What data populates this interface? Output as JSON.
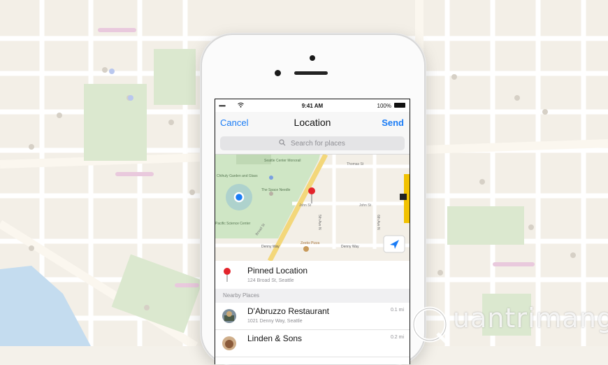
{
  "status_bar": {
    "signal": "•••••",
    "time": "9:41 AM",
    "battery": "100%"
  },
  "nav": {
    "cancel": "Cancel",
    "title": "Location",
    "send": "Send"
  },
  "search": {
    "placeholder": "Search for places"
  },
  "map_labels": {
    "seattle_center": "Seattle Center Monorail",
    "chihuly": "Chihuly Garden and Glass",
    "thomas": "Thomas St",
    "space_needle": "The Space Needle",
    "john": "John St",
    "john2": "John St",
    "fifth": "5th Ave N",
    "sixth": "6th Ave N",
    "science": "Pacific Science Center",
    "broad": "Broad St",
    "denny1": "Denny Way",
    "zeeks": "Zeeks Pizza",
    "denny2": "Denny Way"
  },
  "pinned": {
    "title": "Pinned Location",
    "address": "124 Broad St, Seattle"
  },
  "section": {
    "nearby": "Nearby Places"
  },
  "places": [
    {
      "name": "D'Abruzzo Restaurant",
      "address": "1021 Denny Way, Seattle",
      "distance": "0.1 mi"
    },
    {
      "name": "Linden & Sons",
      "address": "",
      "distance": "0.2 mi"
    }
  ],
  "watermark": {
    "text": "uantrimang"
  },
  "colors": {
    "accent": "#1a7cf6",
    "pin": "#e3242b",
    "park": "#cfe6c5",
    "water": "#a9d3f2"
  }
}
